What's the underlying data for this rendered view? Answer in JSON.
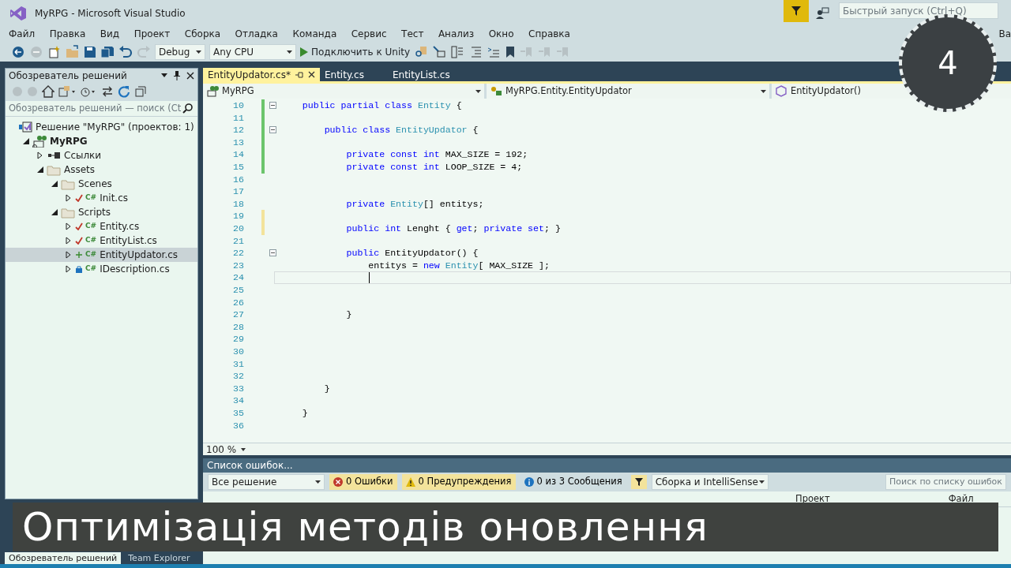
{
  "window": {
    "title": "MyRPG - Microsoft Visual Studio"
  },
  "quick_launch": {
    "placeholder": "Быстрый запуск (Ctrl+Q)"
  },
  "menu": [
    "Файл",
    "Правка",
    "Вид",
    "Проект",
    "Сборка",
    "Отладка",
    "Команда",
    "Сервис",
    "Тест",
    "Анализ",
    "Окно",
    "Справка"
  ],
  "account_name": "Ва",
  "toolbar": {
    "configuration": "Debug",
    "platform": "Any CPU",
    "run_label": "Подключить к Unity"
  },
  "solution_explorer": {
    "title": "Обозреватель решений",
    "search": {
      "placeholder": "Обозреватель решений — поиск (Ct"
    },
    "tree": [
      {
        "label": "Решение \"MyRPG\"  (проектов: 1)",
        "kind": "solution",
        "selected": false,
        "children": [
          {
            "label": "MyRPG",
            "kind": "project",
            "expanded": true,
            "selected": false,
            "children": [
              {
                "label": "Ссылки",
                "kind": "references",
                "expanded": false,
                "selected": false
              },
              {
                "label": "Assets",
                "kind": "folder",
                "expanded": true,
                "selected": false,
                "children": [
                  {
                    "label": "Scenes",
                    "kind": "folder",
                    "expanded": true,
                    "selected": false,
                    "children": [
                      {
                        "label": "Init.cs",
                        "kind": "csharp",
                        "icon_label": "C#",
                        "badge": {
                          "kind": "checked_in"
                        },
                        "expanded": false,
                        "selected": false
                      }
                    ]
                  },
                  {
                    "label": "Scripts",
                    "kind": "folder",
                    "expanded": true,
                    "selected": false,
                    "children": [
                      {
                        "label": "Entity.cs",
                        "kind": "csharp",
                        "icon_label": "C#",
                        "badge": {
                          "kind": "checked_in"
                        },
                        "expanded": false,
                        "selected": false
                      },
                      {
                        "label": "EntityList.cs",
                        "kind": "csharp",
                        "icon_label": "C#",
                        "badge": {
                          "kind": "checked_in"
                        },
                        "expanded": false,
                        "selected": false
                      },
                      {
                        "label": "EntityUpdator.cs",
                        "kind": "csharp",
                        "icon_label": "C#",
                        "badge": {
                          "kind": "added"
                        },
                        "expanded": false,
                        "selected": true
                      },
                      {
                        "label": "IDescription.cs",
                        "kind": "csharp",
                        "icon_label": "C#",
                        "badge": {
                          "kind": "locked"
                        },
                        "expanded": false,
                        "selected": false
                      }
                    ]
                  }
                ]
              }
            ]
          }
        ]
      }
    ]
  },
  "editor": {
    "tabs": [
      {
        "label": "EntityUpdator.cs*",
        "selected": true
      },
      {
        "label": "Entity.cs",
        "selected": false
      },
      {
        "label": "EntityList.cs",
        "selected": false
      }
    ],
    "nav": [
      "MyRPG",
      "MyRPG.Entity.EntityUpdator",
      "EntityUpdator()"
    ],
    "lines": [
      {
        "number": "10",
        "fold": true,
        "change": {
          "kind": "saved"
        },
        "tokens": [
          {
            "kind": "kw",
            "text": "    public partial class "
          },
          {
            "kind": "type",
            "text": "Entity"
          },
          {
            "kind": "plain",
            "text": " {"
          }
        ]
      },
      {
        "number": "11",
        "change": {
          "kind": "saved"
        }
      },
      {
        "number": "12",
        "fold": true,
        "change": {
          "kind": "saved"
        },
        "tokens": [
          {
            "kind": "kw",
            "text": "        public class "
          },
          {
            "kind": "type",
            "text": "EntityUpdator"
          },
          {
            "kind": "plain",
            "text": " {"
          }
        ]
      },
      {
        "number": "13",
        "change": {
          "kind": "saved"
        }
      },
      {
        "number": "14",
        "change": {
          "kind": "saved"
        },
        "tokens": [
          {
            "kind": "kw",
            "text": "            private const int "
          },
          {
            "kind": "plain",
            "text": "MAX_SIZE = 192;"
          }
        ]
      },
      {
        "number": "15",
        "change": {
          "kind": "saved"
        },
        "tokens": [
          {
            "kind": "kw",
            "text": "            private const int "
          },
          {
            "kind": "plain",
            "text": "LOOP_SIZE = 4;"
          }
        ]
      },
      {
        "number": "16"
      },
      {
        "number": "17"
      },
      {
        "number": "18",
        "tokens": [
          {
            "kind": "kw",
            "text": "            private "
          },
          {
            "kind": "type",
            "text": "Entity"
          },
          {
            "kind": "plain",
            "text": "[] entitys;"
          }
        ]
      },
      {
        "number": "19",
        "change": {
          "kind": "unsaved"
        }
      },
      {
        "number": "20",
        "change": {
          "kind": "unsaved"
        },
        "tokens": [
          {
            "kind": "kw",
            "text": "            public int "
          },
          {
            "kind": "plain",
            "text": "Lenght { "
          },
          {
            "kind": "kw",
            "text": "get"
          },
          {
            "kind": "plain",
            "text": "; "
          },
          {
            "kind": "kw",
            "text": "private set"
          },
          {
            "kind": "plain",
            "text": "; }"
          }
        ]
      },
      {
        "number": "21"
      },
      {
        "number": "22",
        "fold": true,
        "tokens": [
          {
            "kind": "kw",
            "text": "            public "
          },
          {
            "kind": "plain",
            "text": "EntityUpdator() {"
          }
        ]
      },
      {
        "number": "23",
        "tokens": [
          {
            "kind": "plain",
            "text": "                entitys = "
          },
          {
            "kind": "kw",
            "text": "new "
          },
          {
            "kind": "type",
            "text": "Entity"
          },
          {
            "kind": "plain",
            "text": "[ MAX_SIZE ];"
          }
        ]
      },
      {
        "number": "24",
        "cursor": true
      },
      {
        "number": "25"
      },
      {
        "number": "26"
      },
      {
        "number": "27",
        "tokens": [
          {
            "kind": "plain",
            "text": "            }"
          }
        ]
      },
      {
        "number": "28"
      },
      {
        "number": "29"
      },
      {
        "number": "30"
      },
      {
        "number": "31"
      },
      {
        "number": "32"
      },
      {
        "number": "33",
        "tokens": [
          {
            "kind": "plain",
            "text": "        }"
          }
        ]
      },
      {
        "number": "34"
      },
      {
        "number": "35",
        "tokens": [
          {
            "kind": "plain",
            "text": "    }"
          }
        ]
      },
      {
        "number": "36"
      }
    ],
    "zoom": "100 %"
  },
  "error_list": {
    "title": "Список ошибок...",
    "scope": "Все решение",
    "filters": [
      {
        "kind": "error",
        "label": "0 Ошибки",
        "on": true
      },
      {
        "kind": "warning",
        "label": "0 Предупреждения",
        "on": true
      },
      {
        "kind": "info",
        "label": "0 из 3 Сообщения",
        "on": false
      }
    ],
    "source": "Сборка и IntelliSense",
    "search": {
      "placeholder": "Поиск по списку ошибок"
    },
    "columns": [
      "Проект",
      "Файл"
    ]
  },
  "bottom_tabs": [
    {
      "label": "Обозреватель решений",
      "selected": true
    },
    {
      "label": "Team Explorer",
      "selected": false
    }
  ],
  "caption": "Оптимізація методів оновлення",
  "step_badge": "4"
}
